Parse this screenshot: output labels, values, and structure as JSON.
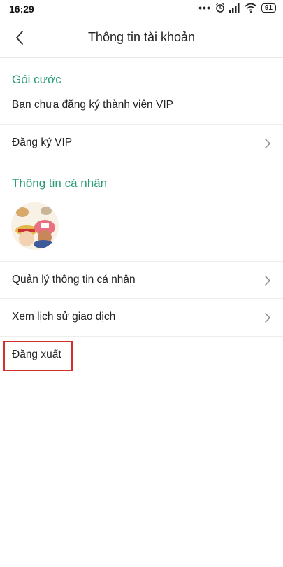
{
  "status_bar": {
    "time": "16:29",
    "battery": "91"
  },
  "header": {
    "title": "Thông tin tài khoản"
  },
  "sections": {
    "plan": {
      "title": "Gói cước",
      "status_text": "Bạn chưa đăng ký thành viên VIP",
      "register_label": "Đăng ký VIP"
    },
    "personal": {
      "title": "Thông tin cá nhân",
      "manage_label": "Quản lý thông tin cá nhân",
      "history_label": "Xem lịch sử giao dịch",
      "logout_label": "Đăng xuất"
    }
  },
  "colors": {
    "accent": "#2a9d73",
    "highlight": "#d32f2f"
  }
}
